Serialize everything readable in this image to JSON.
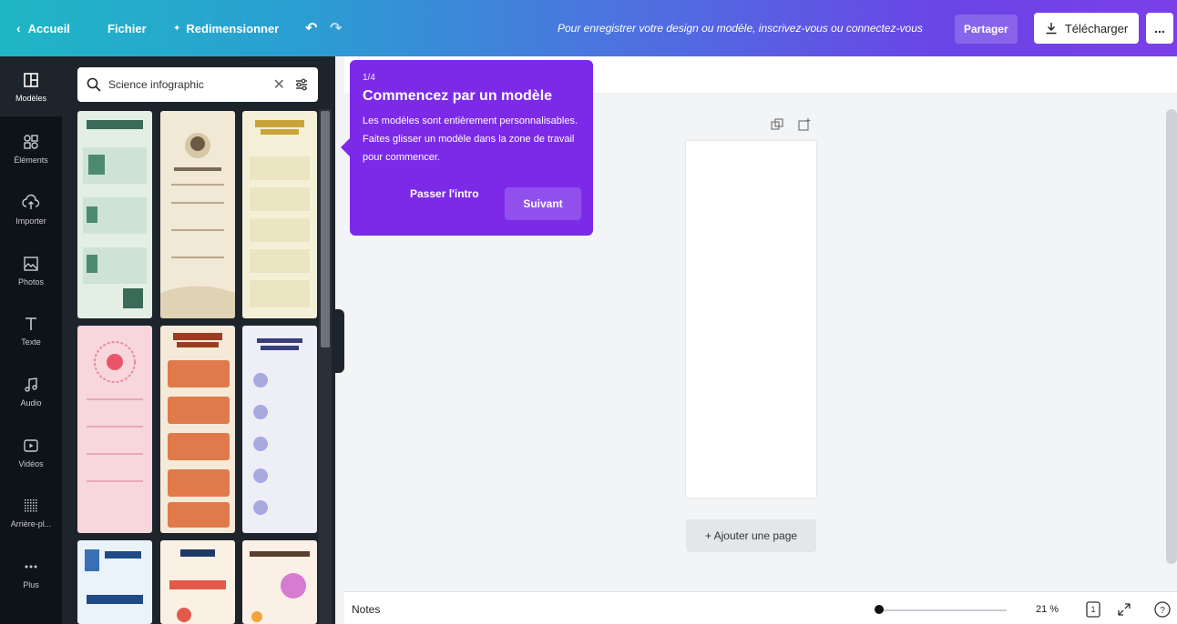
{
  "topbar": {
    "home_label": "Accueil",
    "file_label": "Fichier",
    "resize_label": "Redimensionner",
    "notice": "Pour enregistrer votre design ou modèle, inscrivez-vous ou connectez-vous",
    "share_label": "Partager",
    "download_label": "Télécharger",
    "more_label": "..."
  },
  "rail": {
    "items": [
      {
        "label": "Modèles",
        "icon": "templates-icon"
      },
      {
        "label": "Éléments",
        "icon": "elements-icon"
      },
      {
        "label": "Importer",
        "icon": "upload-icon"
      },
      {
        "label": "Photos",
        "icon": "photos-icon"
      },
      {
        "label": "Texte",
        "icon": "text-icon"
      },
      {
        "label": "Audio",
        "icon": "audio-icon"
      },
      {
        "label": "Vidéos",
        "icon": "video-icon"
      },
      {
        "label": "Arrière-pl...",
        "icon": "background-icon"
      },
      {
        "label": "Plus",
        "icon": "more-icon"
      }
    ]
  },
  "panel": {
    "search_value": "Science infographic"
  },
  "tour": {
    "step": "1/4",
    "title": "Commencez par un modèle",
    "body": "Les modèles sont entièrement personnalisables. Faites glisser un modèle dans la zone de travail pour commencer.",
    "skip_label": "Passer l'intro",
    "next_label": "Suivant"
  },
  "canvas": {
    "add_page_label": "+ Ajouter une page"
  },
  "bottom": {
    "notes_label": "Notes",
    "zoom_value": "21 %",
    "page_count": "1",
    "zoom_fraction": 0.21
  },
  "colors": {
    "accent": "#7d2ae8",
    "panel": "#1e242b",
    "rail": "#0e1318"
  }
}
